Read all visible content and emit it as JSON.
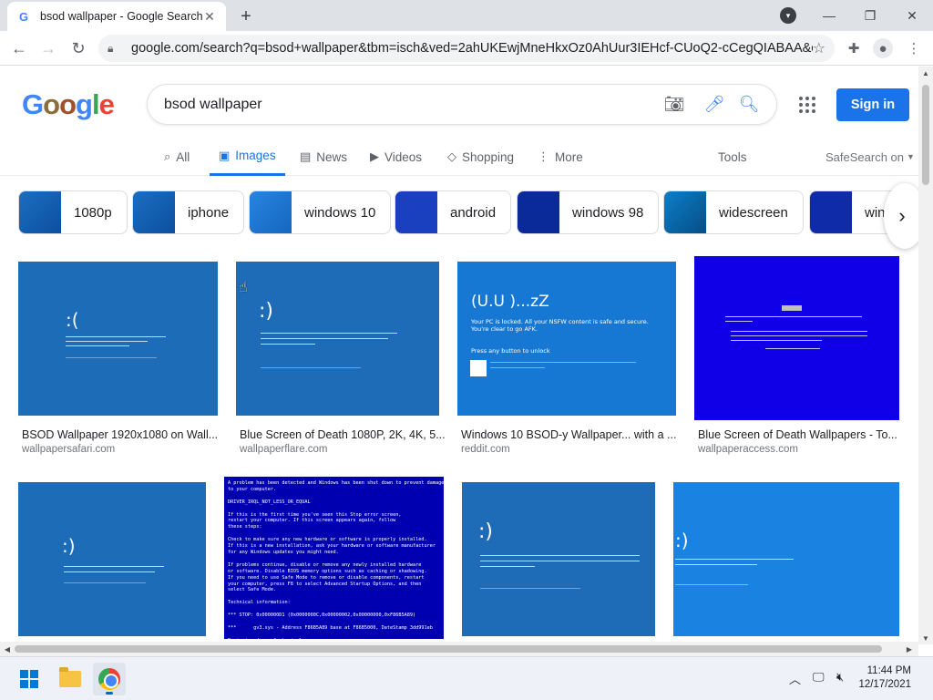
{
  "browser": {
    "tab_title": "bsod wallpaper - Google Search",
    "tab_favicon": "G",
    "url": "google.com/search?q=bsod+wallpaper&tbm=isch&ved=2ahUKEwjMneHkxOz0AhUur3IEHcf-CUoQ2-cCegQIABAA&o..."
  },
  "google": {
    "logo_letters": [
      "G",
      "o",
      "o",
      "g",
      "l",
      "e"
    ],
    "query": "bsod wallpaper",
    "signin_label": "Sign in",
    "tabs": [
      {
        "label": "All",
        "icon": "search-icon"
      },
      {
        "label": "Images",
        "icon": "image-icon"
      },
      {
        "label": "News",
        "icon": "news-icon"
      },
      {
        "label": "Videos",
        "icon": "video-icon"
      },
      {
        "label": "Shopping",
        "icon": "tag-icon"
      },
      {
        "label": "More",
        "icon": "more-vert-icon"
      }
    ],
    "tools_label": "Tools",
    "safesearch_label": "SafeSearch on"
  },
  "chips": [
    "1080p",
    "iphone",
    "windows 10",
    "android",
    "windows 98",
    "widescreen",
    "windows"
  ],
  "results": [
    {
      "title": "BSOD Wallpaper 1920x1080 on Wall...",
      "source": "wallpapersafari.com",
      "caption": ":("
    },
    {
      "title": "Blue Screen of Death 1080P, 2K, 4K, 5...",
      "source": "wallpaperflare.com",
      "caption": ":)"
    },
    {
      "title": "Windows 10 BSOD-y Wallpaper... with a ...",
      "source": "reddit.com",
      "caption": "(U.U )...zZ"
    },
    {
      "title": "Blue Screen of Death Wallpapers - To...",
      "source": "wallpaperaccess.com",
      "caption": ""
    },
    {
      "title": "",
      "source": "",
      "caption": ":)"
    },
    {
      "title": "",
      "source": "",
      "caption": ""
    },
    {
      "title": "",
      "source": "",
      "caption": ":)"
    },
    {
      "title": "",
      "source": "",
      "caption": ":)"
    }
  ],
  "thumb_text": {
    "r2": "Your PC is locked. All your NSFW content is safe and secure.\nYou're clear to go AFK.",
    "r2b": "Press any button to unlock",
    "r5": "A problem has been detected and Windows has been shut down to prevent damage\nto your computer.\n\nDRIVER_IRQL_NOT_LESS_OR_EQUAL\n\nIf this is the first time you've seen this Stop error screen,\nrestart your computer. If this screen appears again, follow\nthese steps:\n\nCheck to make sure any new hardware or software is properly installed.\nIf this is a new installation, ask your hardware or software manufacturer\nfor any Windows updates you might need.\n\nIf problems continue, disable or remove any newly installed hardware\nor software. Disable BIOS memory options such as caching or shadowing.\nIf you need to use Safe Mode to remove or disable components, restart\nyour computer, press F8 to select Advanced Startup Options, and then\nselect Safe Mode.\n\nTechnical information:\n\n*** STOP: 0x000000D1 (0x0000000C,0x00000002,0x00000000,0xF86B5A89)\n\n***      gv3.sys - Address F86B5A89 base at F86B5000, DateStamp 3dd991eb\n\nBeginning dump of physical memory\nPhysical memory dump complete.\nContact your system administrator or technical support group for further\nassistance."
  },
  "taskbar": {
    "time": "11:44 PM",
    "date": "12/17/2021"
  },
  "colors": {
    "accent": "#1a73e8",
    "bsod_blue": "#1e6bb8",
    "classic_blue": "#0000aa"
  }
}
